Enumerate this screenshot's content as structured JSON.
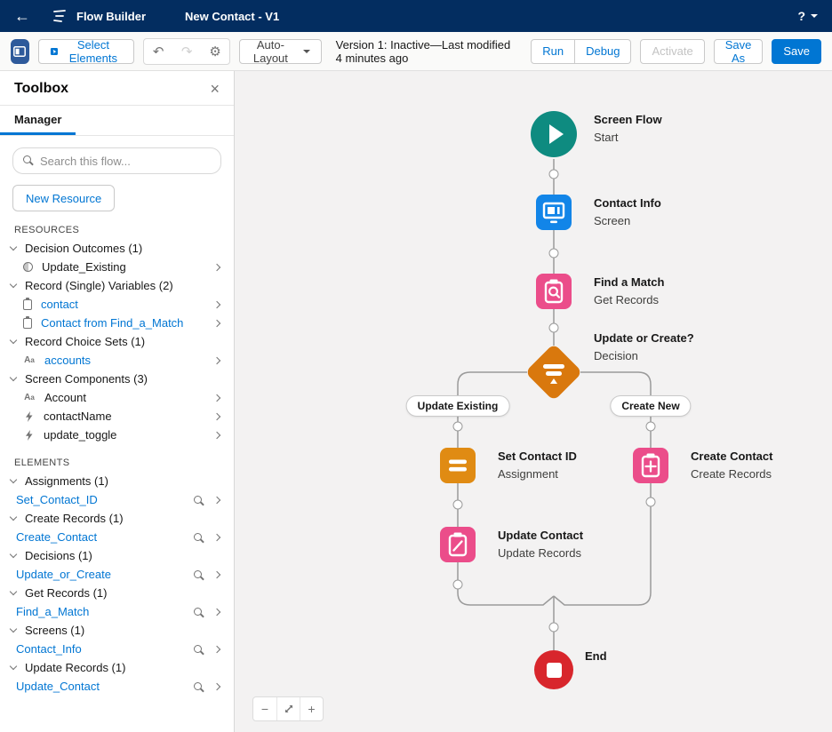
{
  "colors": {
    "header_bg": "#032d60",
    "accent": "#0176d3",
    "canvas_bg": "#f3f2f2",
    "start_teal": "#0e8b80",
    "screen_blue": "#1285e8",
    "data_pink": "#eb4d8a",
    "logic_orange": "#d9780d",
    "assign_orange": "#e08b13",
    "end_red": "#d8262c",
    "wire_gray": "#9a9a9a"
  },
  "header": {
    "app": "Flow Builder",
    "flow_title": "New Contact - V1",
    "help": "?"
  },
  "toolbar": {
    "select_elements": "Select Elements",
    "auto_layout": "Auto-Layout",
    "version_text": "Version 1: Inactive—Last modified 4 minutes ago",
    "run": "Run",
    "debug": "Debug",
    "activate": "Activate",
    "save_as": "Save As",
    "save": "Save"
  },
  "toolbox": {
    "title": "Toolbox",
    "tab": "Manager",
    "search_placeholder": "Search this flow...",
    "new_resource": "New Resource",
    "resources_label": "RESOURCES",
    "elements_label": "ELEMENTS",
    "resources": {
      "groups": [
        {
          "label": "Decision Outcomes (1)",
          "items": [
            {
              "label": "Update_Existing",
              "icon": "outcome-icon"
            }
          ]
        },
        {
          "label": "Record (Single) Variables (2)",
          "items": [
            {
              "label": "contact",
              "icon": "record-variable-icon"
            },
            {
              "label": "Contact from Find_a_Match",
              "icon": "record-variable-icon"
            }
          ]
        },
        {
          "label": "Record Choice Sets (1)",
          "items": [
            {
              "label": "accounts",
              "icon": "choice-set-icon"
            }
          ]
        },
        {
          "label": "Screen Components (3)",
          "items": [
            {
              "label": "Account",
              "icon": "choice-set-icon"
            },
            {
              "label": "contactName",
              "icon": "lightning-icon"
            },
            {
              "label": "update_toggle",
              "icon": "lightning-icon"
            }
          ]
        }
      ]
    },
    "elements": {
      "groups": [
        {
          "label": "Assignments (1)",
          "items": [
            {
              "label": "Set_Contact_ID"
            }
          ]
        },
        {
          "label": "Create Records (1)",
          "items": [
            {
              "label": "Create_Contact"
            }
          ]
        },
        {
          "label": "Decisions (1)",
          "items": [
            {
              "label": "Update_or_Create"
            }
          ]
        },
        {
          "label": "Get Records (1)",
          "items": [
            {
              "label": "Find_a_Match"
            }
          ]
        },
        {
          "label": "Screens (1)",
          "items": [
            {
              "label": "Contact_Info"
            }
          ]
        },
        {
          "label": "Update Records (1)",
          "items": [
            {
              "label": "Update_Contact"
            }
          ]
        }
      ]
    }
  },
  "flow": {
    "nodes": [
      {
        "name": "Screen Flow",
        "type": "Start"
      },
      {
        "name": "Contact Info",
        "type": "Screen"
      },
      {
        "name": "Find a Match",
        "type": "Get Records"
      },
      {
        "name": "Update or Create?",
        "type": "Decision"
      },
      {
        "name": "Set Contact ID",
        "type": "Assignment"
      },
      {
        "name": "Create Contact",
        "type": "Create Records"
      },
      {
        "name": "Update Contact",
        "type": "Update Records"
      },
      {
        "name": "End",
        "type": ""
      }
    ],
    "branch_labels": [
      "Update Existing",
      "Create New"
    ]
  },
  "zoom_controls": {
    "minus": "−",
    "plus": "+"
  },
  "icons": {
    "undo": "↶",
    "redo": "↷",
    "gear": "⚙",
    "close": "×"
  }
}
